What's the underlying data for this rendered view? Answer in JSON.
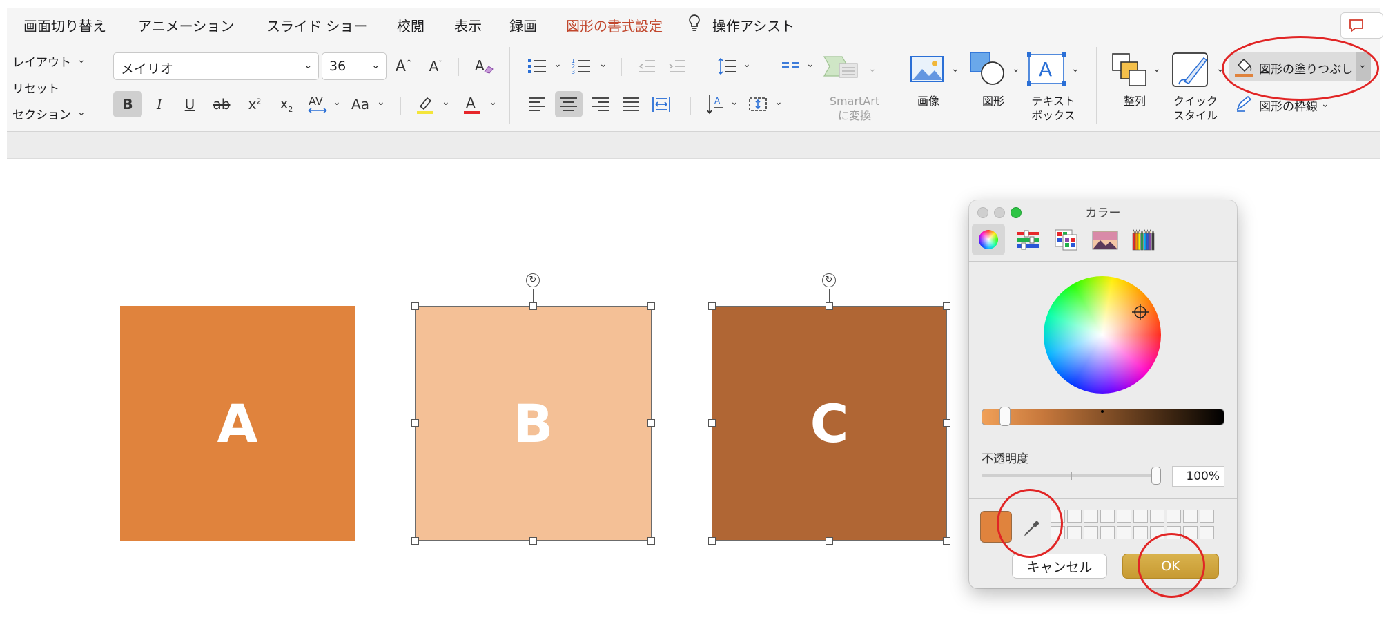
{
  "menu": {
    "items": [
      "画面切り替え",
      "アニメーション",
      "スライド ショー",
      "校閲",
      "表示",
      "録画",
      "図形の書式設定"
    ],
    "assist": "操作アシスト"
  },
  "ribbon": {
    "slides": {
      "layout": "レイアウト",
      "reset": "リセット",
      "section": "セクション"
    },
    "font": {
      "name": "メイリオ",
      "size": "36"
    },
    "smartart": {
      "line1": "SmartArt",
      "line2": "に変換"
    },
    "insert": {
      "image": "画像",
      "shape": "図形",
      "textbox_line1": "テキスト",
      "textbox_line2": "ボックス"
    },
    "arrange": {
      "label": "整列"
    },
    "quick_style": {
      "line1": "クイック",
      "line2": "スタイル"
    },
    "shape_fill": "図形の塗りつぶし",
    "shape_outline": "図形の枠線"
  },
  "slide": {
    "shapes": [
      {
        "label": "A",
        "fill": "#e0833d"
      },
      {
        "label": "B",
        "fill": "#f4c096"
      },
      {
        "label": "C",
        "fill": "#b06634"
      }
    ]
  },
  "color_dialog": {
    "title": "カラー",
    "opacity_label": "不透明度",
    "opacity_value": "100%",
    "current_color": "#e0833d",
    "cancel": "キャンセル",
    "ok": "OK"
  },
  "colors": {
    "accent_menu": "#c1462c",
    "annotation": "#e12525"
  }
}
